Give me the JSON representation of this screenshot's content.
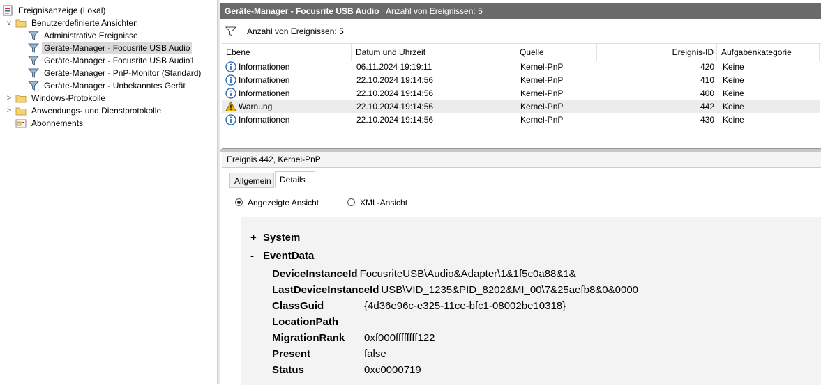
{
  "tree": {
    "root": "Ereignisanzeige (Lokal)",
    "custom_views": "Benutzerdefinierte Ansichten",
    "children": [
      "Administrative Ereignisse",
      "Geräte-Manager - Focusrite USB Audio",
      "Geräte-Manager - Focusrite USB Audio1",
      "Geräte-Manager - PnP-Monitor (Standard)",
      "Geräte-Manager - Unbekanntes Gerät"
    ],
    "windows_logs": "Windows-Protokolle",
    "app_logs": "Anwendungs- und Dienstprotokolle",
    "subscriptions": "Abonnements",
    "expander_collapsed": ">",
    "expander_expanded": "v"
  },
  "panel": {
    "title": "Geräte-Manager - Focusrite USB Audio",
    "count": "Anzahl von Ereignissen: 5"
  },
  "filter": {
    "text": "Anzahl von Ereignissen: 5"
  },
  "columns": [
    "Ebene",
    "Datum und Uhrzeit",
    "Quelle",
    "Ereignis-ID",
    "Aufgabenkategorie"
  ],
  "rows": [
    {
      "level": "Informationen",
      "date": "06.11.2024 19:19:11",
      "source": "Kernel-PnP",
      "id": "420",
      "task": "Keine",
      "icon": "info-icon"
    },
    {
      "level": "Informationen",
      "date": "22.10.2024 19:14:56",
      "source": "Kernel-PnP",
      "id": "410",
      "task": "Keine",
      "icon": "info-icon"
    },
    {
      "level": "Informationen",
      "date": "22.10.2024 19:14:56",
      "source": "Kernel-PnP",
      "id": "400",
      "task": "Keine",
      "icon": "info-icon"
    },
    {
      "level": "Warnung",
      "date": "22.10.2024 19:14:56",
      "source": "Kernel-PnP",
      "id": "442",
      "task": "Keine",
      "icon": "warning-icon"
    },
    {
      "level": "Informationen",
      "date": "22.10.2024 19:14:56",
      "source": "Kernel-PnP",
      "id": "430",
      "task": "Keine",
      "icon": "info-icon"
    }
  ],
  "event": {
    "header": "Ereignis 442, Kernel-PnP",
    "tabs": [
      "Allgemein",
      "Details"
    ],
    "view_options": [
      "Angezeigte Ansicht",
      "XML-Ansicht"
    ],
    "system": {
      "toggle": "+",
      "label": "System"
    },
    "eventdata": {
      "toggle": "-",
      "label": "EventData"
    },
    "fields": [
      {
        "key": "DeviceInstanceId",
        "value": "FocusriteUSB\\Audio&Adapter\\1&1f5c0a88&1&"
      },
      {
        "key": "LastDeviceInstanceId",
        "value": "USB\\VID_1235&PID_8202&MI_00\\7&25aefb8&0&0000"
      },
      {
        "key": "ClassGuid",
        "value": "{4d36e96c-e325-11ce-bfc1-08002be10318}"
      },
      {
        "key": "LocationPath",
        "value": ""
      },
      {
        "key": "MigrationRank",
        "value": "0xf000ffffffff122"
      },
      {
        "key": "Present",
        "value": "false"
      },
      {
        "key": "Status",
        "value": "0xc0000719"
      }
    ]
  },
  "colors": {
    "title_bar": "#6a6a6a",
    "selection": "#d9d9d9",
    "warning": "#e8b400",
    "info": "#1f5fa8"
  }
}
